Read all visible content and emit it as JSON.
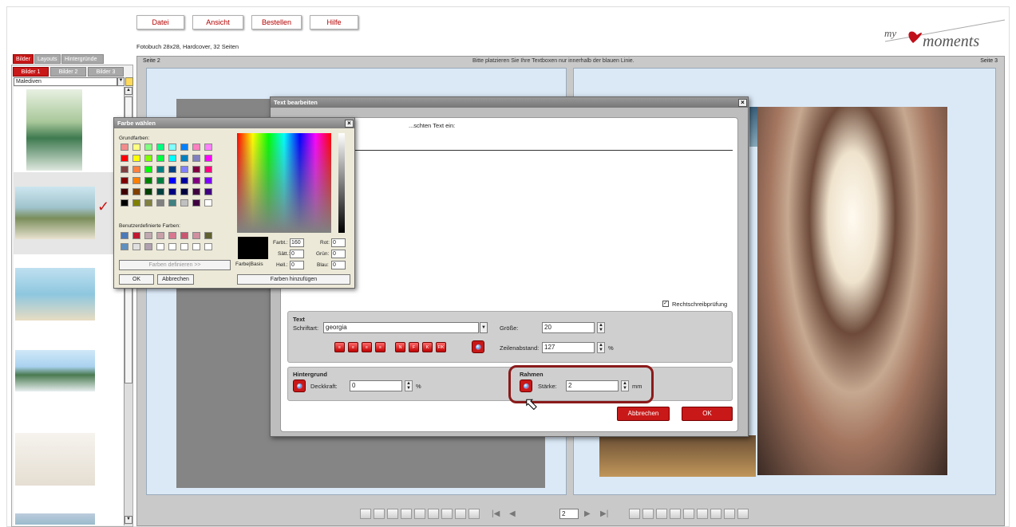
{
  "menu": {
    "datei": "Datei",
    "ansicht": "Ansicht",
    "bestellen": "Bestellen",
    "hilfe": "Hilfe"
  },
  "product_info": "Fotobuch 28x28, Hardcover, 32 Seiten",
  "logo": {
    "my": "my",
    "moments": "moments"
  },
  "side_tabs": {
    "bilder": "Bilder",
    "layouts": "Layouts",
    "hintergruende": "Hintergründe"
  },
  "sub_tabs": {
    "bilder1": "Bilder 1",
    "bilder2": "Bilder 2",
    "bilder3": "Bilder 3"
  },
  "album": {
    "selected": "Malediven"
  },
  "workspace": {
    "page_left": "Seite 2",
    "page_right": "Seite 3",
    "hint": "Bitte platzieren Sie Ihre Textboxen nur innerhalb der blauen Linie."
  },
  "nav": {
    "page_number": "2"
  },
  "text_dialog": {
    "title": "Text bearbeiten",
    "prompt": "...schten Text ein:",
    "spellcheck": "Rechtschreibprüfung",
    "text_section": "Text",
    "font_label": "Schriftart:",
    "font_value": "georgia",
    "size_label": "Größe:",
    "size_value": "20",
    "line_label": "Zeilenabstand:",
    "line_value": "127",
    "percent": "%",
    "bg_section": "Hintergrund",
    "opacity_label": "Deckkraft:",
    "opacity_value": "0",
    "frame_section": "Rahmen",
    "strength_label": "Stärke:",
    "strength_value": "2",
    "mm": "mm",
    "cancel": "Abbrechen",
    "ok": "OK",
    "format_buttons": [
      "≡",
      "≡",
      "≡",
      "≡",
      "N",
      "F",
      "K",
      "F/K"
    ]
  },
  "color_dialog": {
    "title": "Farbe wählen",
    "basic_colors": "Grundfarben:",
    "custom_colors": "Benutzerdefinierte Farben:",
    "define_custom": "Farben definieren >>",
    "ok": "OK",
    "cancel": "Abbrechen",
    "add_colors": "Farben hinzufügen",
    "solid_label": "Farbe|Basis",
    "hue_label": "Farbt.:",
    "hue": "160",
    "sat_label": "Sätt.:",
    "sat": "0",
    "lum_label": "Hell.:",
    "lum": "0",
    "red_label": "Rot:",
    "red": "0",
    "green_label": "Grün:",
    "green": "0",
    "blue_label": "Blau:",
    "blue": "0",
    "basic_palette": [
      "#f28c8c",
      "#ffff80",
      "#80ff80",
      "#00ff80",
      "#80ffff",
      "#0080ff",
      "#ff80c0",
      "#ff80ff",
      "#ff0000",
      "#ffff00",
      "#80ff00",
      "#00ff40",
      "#00ffff",
      "#0080c0",
      "#8080c0",
      "#ff00ff",
      "#804040",
      "#ff8040",
      "#00ff00",
      "#008080",
      "#004080",
      "#8080ff",
      "#800040",
      "#ff0080",
      "#800000",
      "#ff8000",
      "#008000",
      "#008040",
      "#0000ff",
      "#0000a0",
      "#800080",
      "#8000ff",
      "#400000",
      "#804000",
      "#004000",
      "#004040",
      "#000080",
      "#000040",
      "#400040",
      "#400080",
      "#000000",
      "#808000",
      "#808040",
      "#808080",
      "#408080",
      "#c0c0c0",
      "#400040",
      "#ffffff"
    ],
    "custom_palette": [
      "#4a7ab8",
      "#c01830",
      "#c0a8b0",
      "#c8a0a8",
      "#d87890",
      "#c85870",
      "#d090a0",
      "#606030",
      "#6090c0",
      "#e0e0e0",
      "#b0a0b0",
      "#ffffff",
      "#ffffff",
      "#ffffff",
      "#ffffff",
      "#ffffff"
    ]
  },
  "colors": {
    "accent": "#c81818",
    "highlight": "#8b1a1a"
  }
}
